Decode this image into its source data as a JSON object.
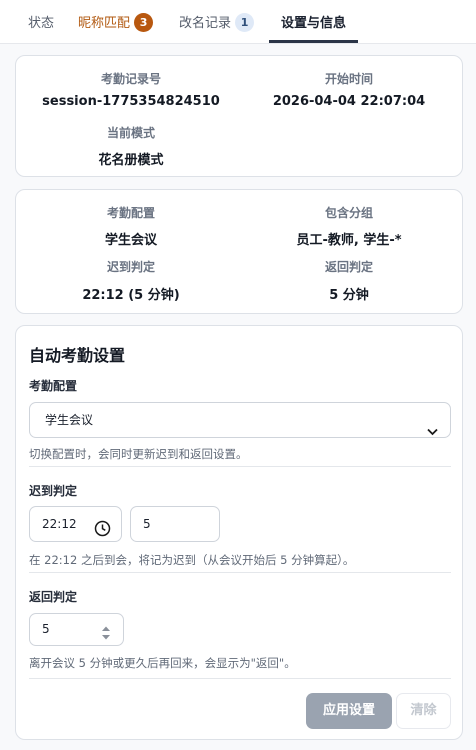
{
  "tabs": [
    {
      "label": "状态"
    },
    {
      "label": "昵称匹配",
      "badge": "3"
    },
    {
      "label": "改名记录",
      "badge": "1"
    },
    {
      "label": "设置与信息"
    }
  ],
  "session_card": {
    "record_label": "考勤记录号",
    "record_value": "session-1775354824510",
    "start_label": "开始时间",
    "start_value": "2026-04-04 22:07:04",
    "mode_label": "当前模式",
    "mode_value": "花名册模式"
  },
  "config_card": {
    "config_label": "考勤配置",
    "config_value": "学生会议",
    "groups_label": "包含分组",
    "groups_value": "员工-教师, 学生-*",
    "late_label": "迟到判定",
    "late_value": "22:12 (5 分钟)",
    "return_label": "返回判定",
    "return_value": "5 分钟"
  },
  "settings": {
    "title": "自动考勤设置",
    "config_field_label": "考勤配置",
    "config_select_value": "学生会议",
    "config_hint": "切换配置时，会同时更新迟到和返回设置。",
    "late_field_label": "迟到判定",
    "late_time_value": "22:12",
    "late_minutes_value": "5",
    "late_hint": "在 22:12 之后到会，将记为迟到（从会议开始后 5 分钟算起）。",
    "return_field_label": "返回判定",
    "return_minutes_value": "5",
    "return_hint": "离开会议 5 分钟或更久后再回来，会显示为\"返回\"。",
    "apply_label": "应用设置",
    "clear_label": "清除"
  }
}
